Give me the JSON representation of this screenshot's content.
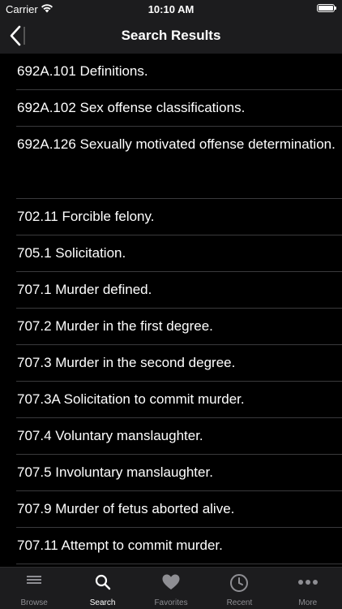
{
  "status_bar": {
    "carrier": "Carrier",
    "time": "10:10 AM"
  },
  "nav": {
    "title": "Search Results",
    "back_icon": "chevron-left-icon"
  },
  "results": [
    "692A.101 Definitions.",
    "692A.102 Sex offense classifications.",
    "692A.126 Sexually motivated offense determination.",
    "702.11 Forcible felony.",
    "705.1 Solicitation.",
    "707.1 Murder defined.",
    "707.2 Murder in the first degree.",
    "707.3 Murder in the second degree.",
    "707.3A Solicitation to commit murder.",
    "707.4 Voluntary manslaughter.",
    "707.5 Involuntary manslaughter.",
    "707.9 Murder of fetus aborted alive.",
    "707.11 Attempt to commit murder."
  ],
  "tab_bar": {
    "tabs": [
      {
        "label": "Browse",
        "icon": "list-icon"
      },
      {
        "label": "Search",
        "icon": "search-icon"
      },
      {
        "label": "Favorites",
        "icon": "heart-icon"
      },
      {
        "label": "Recent",
        "icon": "clock-icon"
      },
      {
        "label": "More",
        "icon": "more-icon"
      }
    ],
    "active": "Search"
  }
}
